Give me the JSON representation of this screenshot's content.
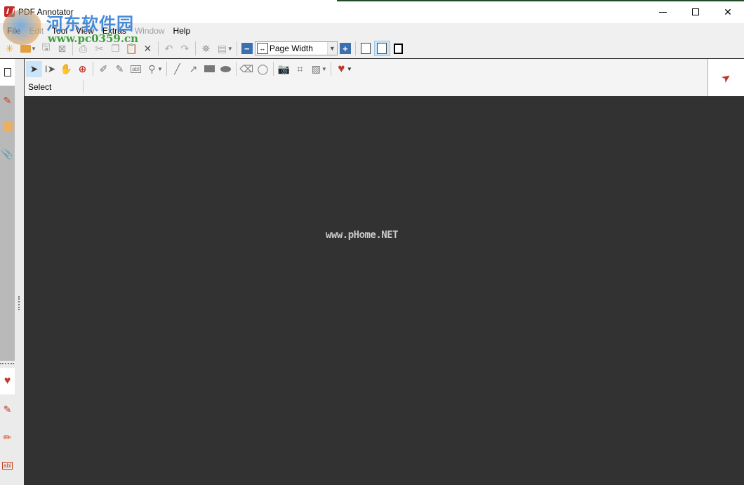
{
  "window": {
    "title": "PDF Annotator",
    "controls": {
      "minimize": "minimize",
      "maximize": "maximize",
      "close": "close"
    }
  },
  "menubar": {
    "items": [
      {
        "label": "File",
        "enabled": true
      },
      {
        "label": "Edit",
        "enabled": false
      },
      {
        "label": "Tool",
        "enabled": true
      },
      {
        "label": "View",
        "enabled": true
      },
      {
        "label": "Extras",
        "enabled": true
      },
      {
        "label": "Window",
        "enabled": false
      },
      {
        "label": "Help",
        "enabled": true
      }
    ]
  },
  "toolbar": {
    "icons": [
      "new-document-icon",
      "open-folder-icon",
      "save-icon",
      "save-as-icon",
      "print-icon",
      "cut-icon",
      "copy-icon",
      "paste-icon",
      "delete-icon",
      "undo-icon",
      "redo-icon",
      "find-icon",
      "page-layout-icon"
    ],
    "zoom": {
      "selected": "Page Width",
      "zoom_out": "−",
      "zoom_in": "+"
    },
    "view_modes": [
      "whole-page",
      "page-width",
      "full-screen"
    ]
  },
  "annotation_toolbar": {
    "tools": [
      "select",
      "text-select",
      "hand",
      "zoom",
      "pen",
      "marker",
      "text-box",
      "stamp",
      "line",
      "arrow",
      "rectangle",
      "ellipse",
      "eraser",
      "lasso",
      "snapshot",
      "crop",
      "insert-image",
      "favorites"
    ],
    "current_tool_label": "Select"
  },
  "document": {
    "watermark": "www.pHome.NET"
  },
  "overlay_brand": {
    "name_cn": "河东软件园",
    "url": "www.pc0359.cn"
  },
  "colors": {
    "accent_blue": "#3a6fb0",
    "tool_red": "#c0392b",
    "doc_background": "#323232",
    "active_tool_bg": "#cce4f7"
  }
}
